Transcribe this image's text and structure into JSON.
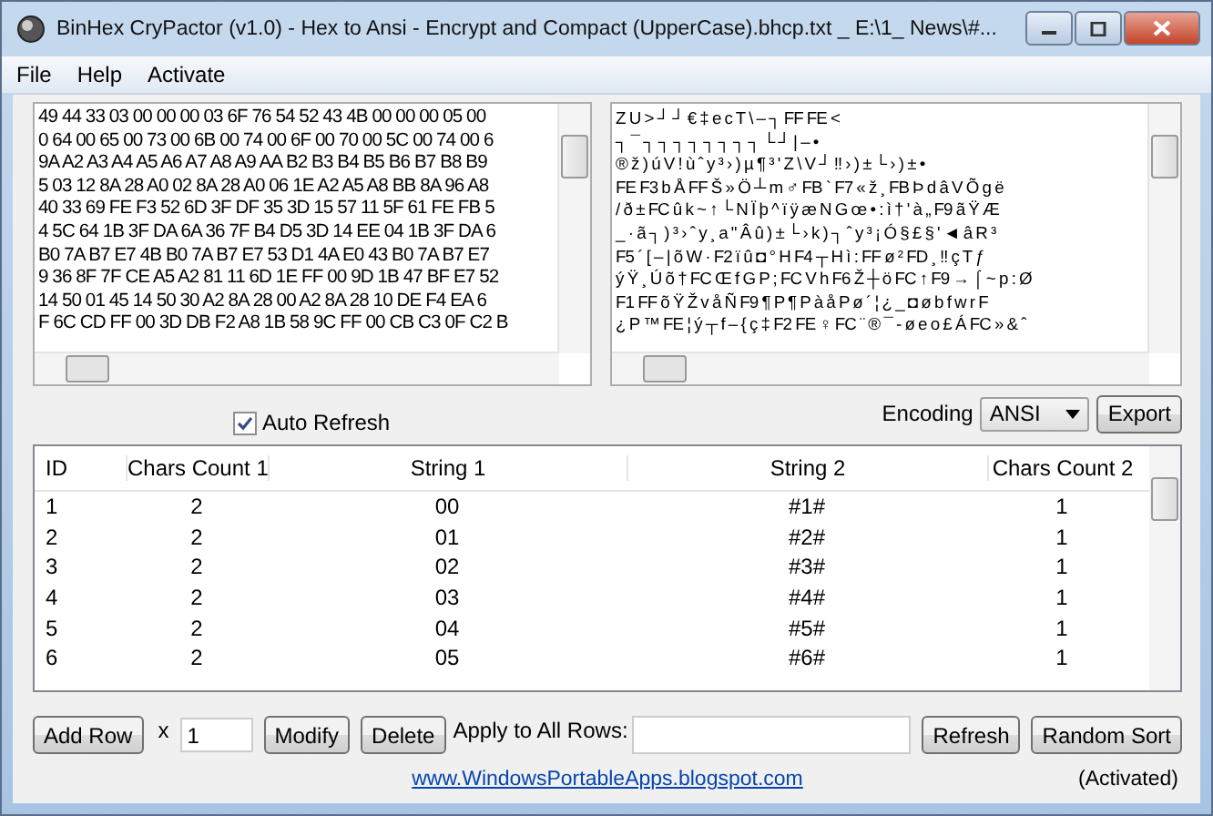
{
  "window": {
    "title": "BinHex CryPactor (v1.0) - Hex to Ansi - Encrypt and Compact (UpperCase).bhcp.txt _ E:\\1_ News\\#..."
  },
  "menu": [
    "File",
    "Help",
    "Activate"
  ],
  "hex_pane": {
    "lines": [
      "49 44 33 03 00 00 00 03 6F 76 54 52 43 4B 00 00 00 05 00",
      "0 64 00 65 00 73 00 6B 00 74 00 6F 00 70 00 5C 00 74 00 6",
      "9A A2 A3 A4 A5 A6 A7 A8 A9 AA B2 B3 B4 B5 B6 B7 B8 B9",
      "5 03 12 8A 28 A0 02 8A 28 A0 06 1E A2 A5 A8 BB 8A 96 A8",
      "40 33 69 FE F3 52 6D 3F DF 35 3D 15 57 11 5F 61 FE FB 5",
      "4 5C 64 1B 3F DA 6A 36 7F B4 D5 3D 14 EE 04 1B 3F DA 6",
      "B0 7A B7 E7 4B B0 7A B7 E7 53 D1 4A E0 43 B0 7A B7 E7",
      "9 36 8F 7F CE A5 A2 81 11 6D 1E FF 00 9D 1B 47 BF E7 52",
      "14 50 01 45 14 50 30 A2 8A 28 00 A2 8A 28 10 DE F4 EA 6",
      "F 6C CD FF 00 3D DB F2 A8 1B 58 9C FF 00 CB C3 0F C2 B"
    ]
  },
  "ansi_pane": {
    "lines": [
      "Z U > ┘          ┘ € ‡ e c T \\         –        ┐ FF FE <",
      "      ┐ ¯ ┐ ┐ ┐ ┐ ┐ ┐ ┐                         ┐ └ ┘ | – • ",
      "® ž     ) ú V ! ù ˆ y     ³ › )     µ ¶ ³ ' Z \\ V ┘ ‼ › ) ± └ › ) ± •",
      "FE F3 b Å FF     Š » Ö ┴ m ♂ FB ` F7 « ž ¸ FB Þ d â V Õ g ë",
      "/ ð ± FC û k ~ ↑ └ N Ï þ ^ ï ÿ æ N G œ  • : ì  † ' à „ F9 ã Ÿ Æ",
      "_ · ã ┐ ) ³ ›     ˆ y ¸ a \" Â û ) ± └ › k ) ┐ ˆ y ³ ¡ Ó § £ § ' ◄ â R ³",
      "F5 ´ [ –  |  õ W · F2 ï û ◘ ° H F4 ┬ H ì : FF     ø ² FD ¸ ‼ ç T ƒ",
      "ý Ÿ ¸ Ú õ † FC Œ f G P ; FC V h F6 Ž ┼ ö FC ↑ F9 → ⌠ ~ p : Ø",
      "F1 FF     õ Ÿ Ž v å Ñ F9 ¶ P ¶ P à å P ø ´ ¦ ¿ _ ◘ ø b  f  w r F",
      "¿ P ™ FE ¦ ý ┬ f – { ç ‡  F2 FE ♀ FC ¨ ® ¯ - ø e o £ Á FC » & ˆ"
    ]
  },
  "auto_refresh": {
    "label": "Auto Refresh",
    "checked": true
  },
  "encoding": {
    "label": "Encoding",
    "value": "ANSI"
  },
  "export_button": "Export",
  "table": {
    "columns": [
      "ID",
      "Chars Count 1",
      "String 1",
      "String 2",
      "Chars Count 2"
    ],
    "rows": [
      [
        "1",
        "2",
        "00",
        "#1#",
        "1"
      ],
      [
        "2",
        "2",
        "01",
        "#2#",
        "1"
      ],
      [
        "3",
        "2",
        "02",
        "#3#",
        "1"
      ],
      [
        "4",
        "2",
        "03",
        "#4#",
        "1"
      ],
      [
        "5",
        "2",
        "04",
        "#5#",
        "1"
      ],
      [
        "6",
        "2",
        "05",
        "#6#",
        "1"
      ]
    ]
  },
  "toolbar": {
    "add_row": "Add Row",
    "times": "x",
    "count": "1",
    "modify": "Modify",
    "delete": "Delete",
    "apply_label": "Apply to All Rows:",
    "refresh": "Refresh",
    "random_sort": "Random Sort"
  },
  "footer": {
    "link": "www.WindowsPortableApps.blogspot.com",
    "status": "(Activated)"
  }
}
